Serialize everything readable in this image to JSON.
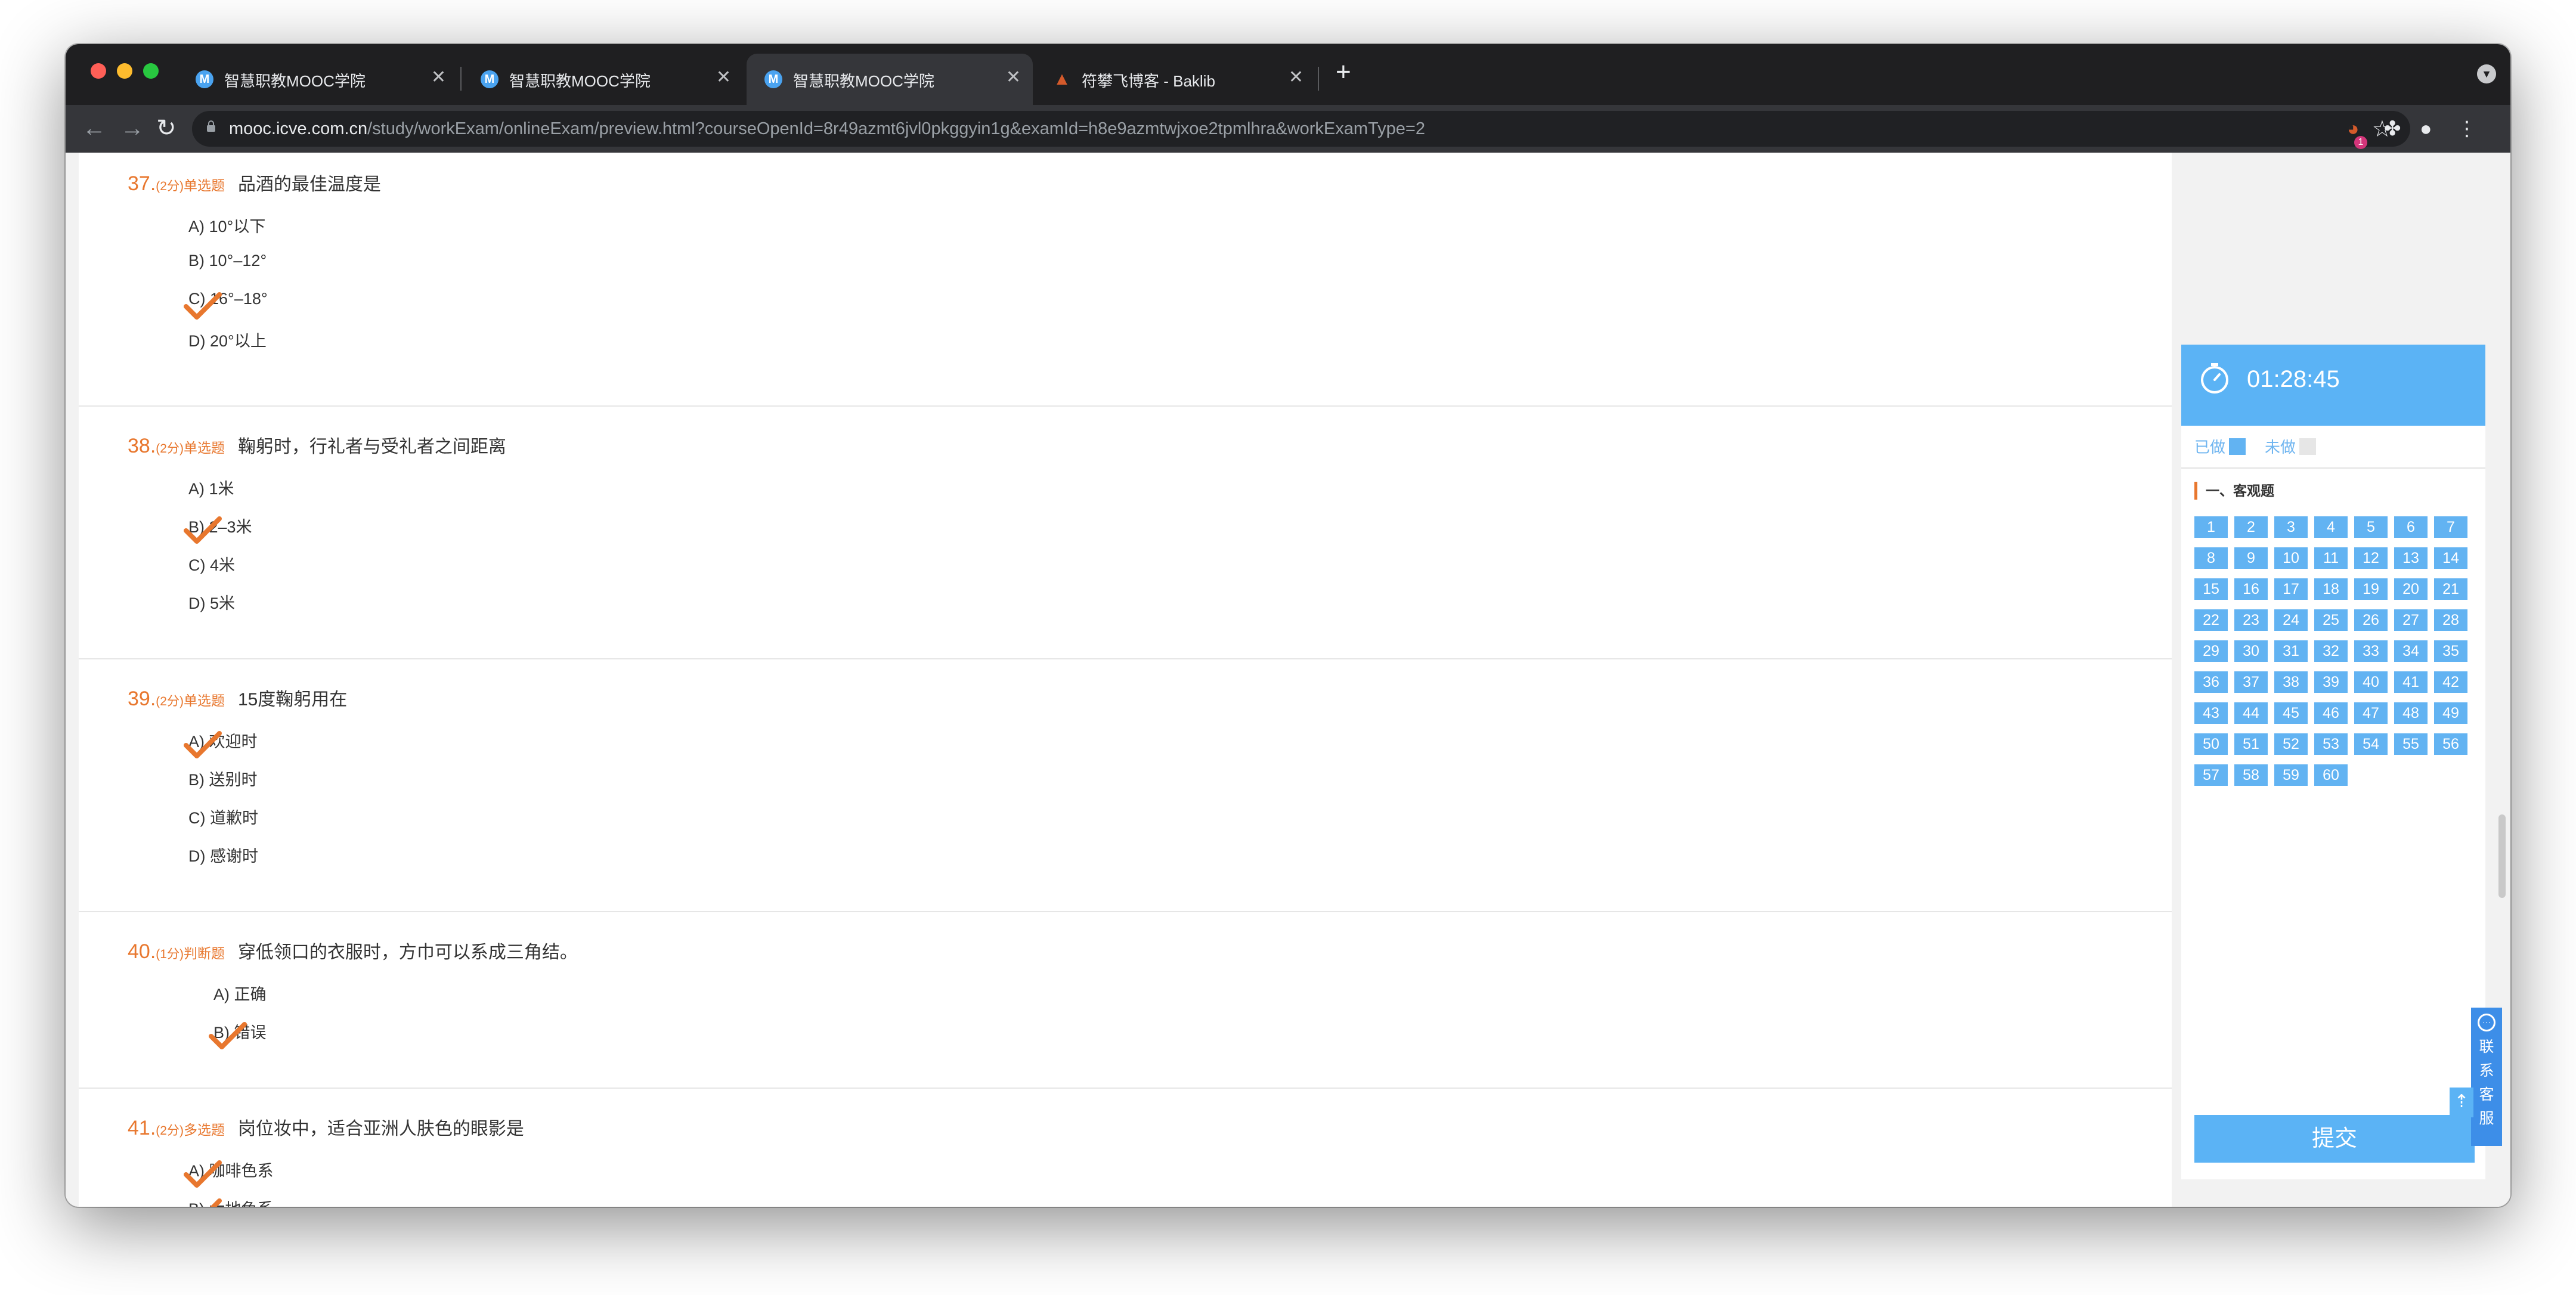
{
  "browser": {
    "tabs": [
      {
        "title": "智慧职教MOOC学院",
        "favicon": "M",
        "active": false
      },
      {
        "title": "智慧职教MOOC学院",
        "favicon": "M",
        "active": false
      },
      {
        "title": "智慧职教MOOC学院",
        "favicon": "M",
        "active": true
      },
      {
        "title": "符攀飞博客 - Baklib",
        "favicon": "Baklib",
        "active": false
      }
    ],
    "close_glyph": "✕",
    "new_tab_glyph": "+",
    "url_host": "mooc.icve.com.cn",
    "url_path": "/study/workExam/onlineExam/preview.html?courseOpenId=8r49azmt6jvl0pkggyin1g&examId=h8e9azmtwjxoe2tpmlhra&workExamType=2",
    "extension_badge": "1"
  },
  "questions": [
    {
      "num": "37.",
      "score": "(2分)",
      "type": "单选题",
      "text": "品酒的最佳温度是",
      "options": [
        "A) 10°以下",
        "B) 10°–12°",
        "C) 16°–18°",
        "D) 20°以上"
      ],
      "checked": [
        2
      ]
    },
    {
      "num": "38.",
      "score": "(2分)",
      "type": "单选题",
      "text": "鞠躬时，行礼者与受礼者之间距离",
      "options": [
        "A) 1米",
        "B) 2–3米",
        "C) 4米",
        "D) 5米"
      ],
      "checked": [
        1
      ]
    },
    {
      "num": "39.",
      "score": "(2分)",
      "type": "单选题",
      "text": "15度鞠躬用在",
      "options": [
        "A) 欢迎时",
        "B) 送别时",
        "C) 道歉时",
        "D) 感谢时"
      ],
      "checked": [
        0
      ]
    },
    {
      "num": "40.",
      "score": "(1分)",
      "type": "判断题",
      "text": "穿低领口的衣服时，方巾可以系成三角结。",
      "options": [
        "A) 正确",
        "B) 错误"
      ],
      "checked": [
        1
      ]
    },
    {
      "num": "41.",
      "score": "(2分)",
      "type": "多选题",
      "text": "岗位妆中，适合亚洲人肤色的眼影是",
      "options": [
        "A) 咖啡色系",
        "B) 大地色系"
      ],
      "checked": [
        0,
        1
      ]
    }
  ],
  "sidebar": {
    "timer": "01:28:45",
    "legend_done": "已做",
    "legend_undone": "未做",
    "section_title": "一、客观题",
    "question_numbers": [
      "1",
      "2",
      "3",
      "4",
      "5",
      "6",
      "7",
      "8",
      "9",
      "10",
      "11",
      "12",
      "13",
      "14",
      "15",
      "16",
      "17",
      "18",
      "19",
      "20",
      "21",
      "22",
      "23",
      "24",
      "25",
      "26",
      "27",
      "28",
      "29",
      "30",
      "31",
      "32",
      "33",
      "34",
      "35",
      "36",
      "37",
      "38",
      "39",
      "40",
      "41",
      "42",
      "43",
      "44",
      "45",
      "46",
      "47",
      "48",
      "49",
      "50",
      "51",
      "52",
      "53",
      "54",
      "55",
      "56",
      "57",
      "58",
      "59",
      "60"
    ],
    "submit_label": "提交",
    "service_label": "联系客服"
  },
  "colors": {
    "accent_orange": "#e8772e",
    "accent_blue": "#5bb3f5",
    "done_blue": "#62b3f2",
    "undone_gray": "#e6e6e6"
  }
}
